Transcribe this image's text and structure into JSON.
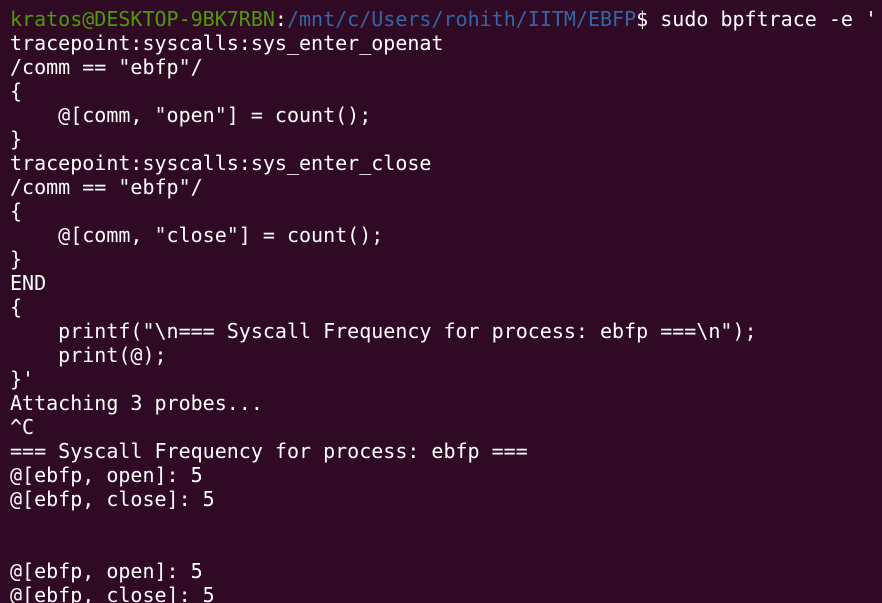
{
  "colors": {
    "background": "#300a24",
    "text": "#ffffff",
    "prompt_user": "#4e9a06",
    "prompt_path": "#3465a4"
  },
  "prompt": {
    "user_host": "kratos@DESKTOP-9BK7RBN",
    "separator": ":",
    "path": "/mnt/c/Users/rohith/IITM/EBFP",
    "dollar": "$",
    "command": " sudo bpftrace -e '"
  },
  "lines": [
    "tracepoint:syscalls:sys_enter_openat",
    "/comm == \"ebfp\"/",
    "{",
    "    @[comm, \"open\"] = count();",
    "}",
    "tracepoint:syscalls:sys_enter_close",
    "/comm == \"ebfp\"/",
    "{",
    "    @[comm, \"close\"] = count();",
    "}",
    "END",
    "{",
    "    printf(\"\\n=== Syscall Frequency for process: ebfp ===\\n\");",
    "    print(@);",
    "}'",
    "Attaching 3 probes...",
    "^C",
    "=== Syscall Frequency for process: ebfp ===",
    "@[ebfp, open]: 5",
    "@[ebfp, close]: 5",
    "",
    "",
    "@[ebfp, open]: 5",
    "@[ebfp, close]: 5"
  ]
}
